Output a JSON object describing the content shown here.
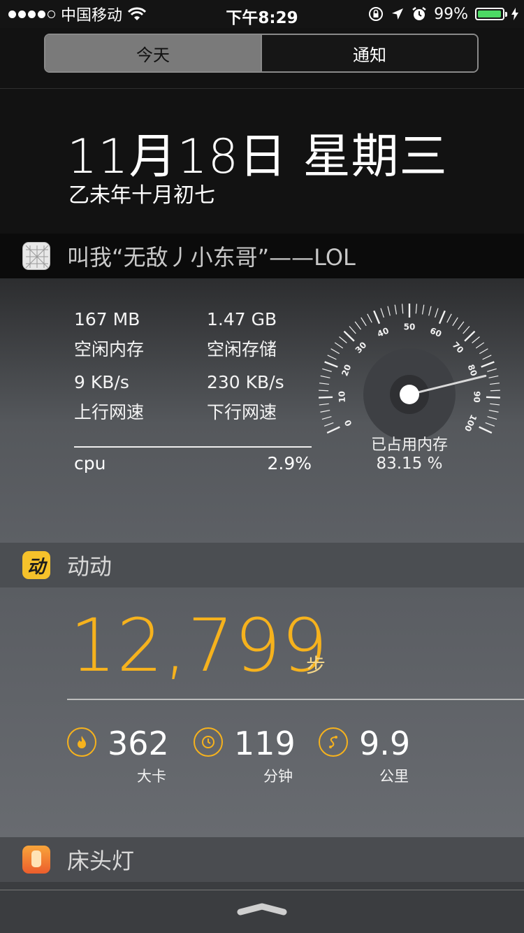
{
  "status_bar": {
    "carrier": "中国移动",
    "time": "下午8:29",
    "battery_percent": "99%",
    "signal_bars_filled": 4,
    "signal_bars_total": 5,
    "battery_color": "#4cd964"
  },
  "segmented_control": {
    "today_label": "今天",
    "notifications_label": "通知",
    "selected": "今天"
  },
  "date": {
    "main": "11月18日 星期三",
    "lunar": "乙未年十月初七"
  },
  "system_widget": {
    "title": "叫我“无敌丿小东哥”——LOL",
    "free_memory_value": "167 MB",
    "free_memory_label": "空闲内存",
    "free_storage_value": "1.47 GB",
    "free_storage_label": "空闲存储",
    "upload_value": "9 KB/s",
    "upload_label": "上行网速",
    "download_value": "230 KB/s",
    "download_label": "下行网速",
    "cpu_label": "cpu",
    "cpu_value": "2.9%",
    "gauge_caption": "已占用内存",
    "gauge_value": "83.15 %",
    "gauge_percent": 83.15,
    "gauge_ticks": [
      "0",
      "10",
      "20",
      "30",
      "40",
      "50",
      "60",
      "70",
      "80",
      "90",
      "100"
    ]
  },
  "dongdong_widget": {
    "title": "动动",
    "icon_char": "动",
    "icon_color": "#f6c22b",
    "steps": "12,799",
    "steps_unit": "步",
    "accent_color": "#f6b21d",
    "metrics": [
      {
        "icon": "flame-icon",
        "value": "362",
        "label": "大卡"
      },
      {
        "icon": "clock-icon",
        "value": "119",
        "label": "分钟"
      },
      {
        "icon": "route-icon",
        "value": "9.9",
        "label": "公里"
      }
    ]
  },
  "lamp_widget": {
    "title": "床头灯"
  }
}
